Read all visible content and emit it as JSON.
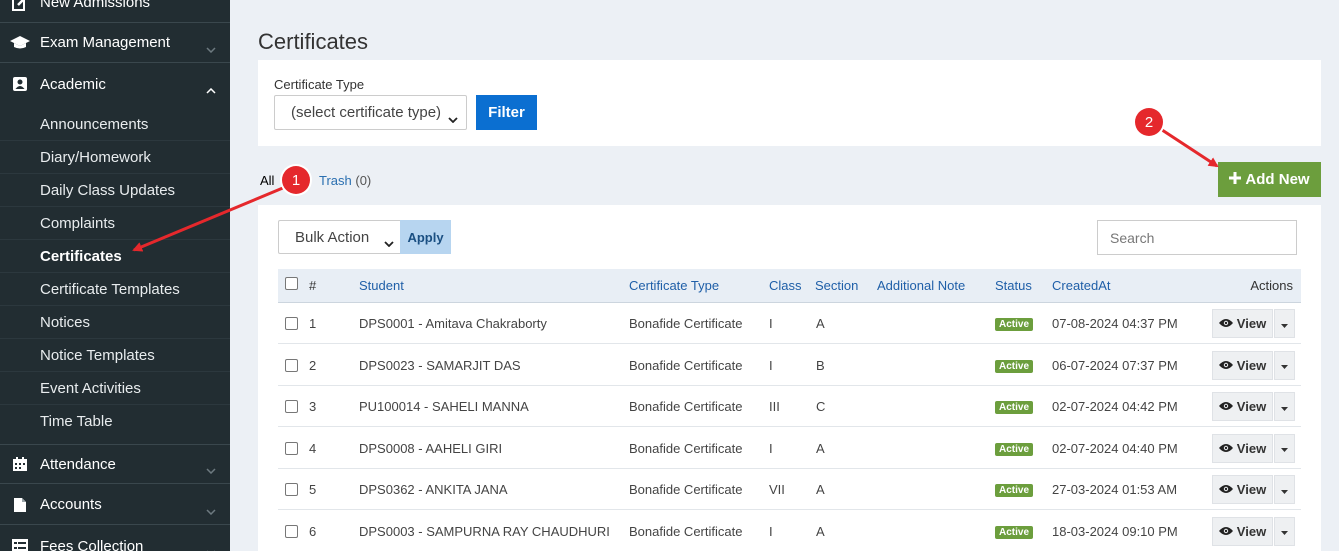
{
  "sidebar": {
    "top_items": [
      {
        "label": "New Admissions",
        "icon": "edit-icon"
      },
      {
        "label": "Exam Management",
        "icon": "graduation-cap-icon"
      },
      {
        "label": "Academic",
        "icon": "id-card-icon"
      }
    ],
    "sub_items": [
      "Announcements",
      "Diary/Homework",
      "Daily Class Updates",
      "Complaints",
      "Certificates",
      "Certificate Templates",
      "Notices",
      "Notice Templates",
      "Event Activities",
      "Time Table"
    ],
    "bottom_items": [
      {
        "label": "Attendance",
        "icon": "calendar-icon"
      },
      {
        "label": "Accounts",
        "icon": "file-icon"
      },
      {
        "label": "Fees Collection",
        "icon": "list-icon"
      }
    ]
  },
  "page": {
    "title": "Certificates"
  },
  "filter": {
    "label": "Certificate Type",
    "select_value": "(select certificate type)",
    "button": "Filter"
  },
  "tabs": {
    "all": "All",
    "trash": "Trash",
    "trash_count": "(0)"
  },
  "add_new": "Add New",
  "toolbar": {
    "bulk_action": "Bulk Action",
    "apply": "Apply",
    "search_placeholder": "Search"
  },
  "table": {
    "headers": {
      "num": "#",
      "student": "Student",
      "type": "Certificate Type",
      "class": "Class",
      "section": "Section",
      "note": "Additional Note",
      "status": "Status",
      "created": "CreatedAt",
      "actions": "Actions"
    },
    "rows": [
      {
        "num": "1",
        "student": "DPS0001 - Amitava Chakraborty",
        "type": "Bonafide Certificate",
        "class": "I",
        "section": "A",
        "status": "Active",
        "created": "07-08-2024 04:37 PM"
      },
      {
        "num": "2",
        "student": "DPS0023 - SAMARJIT DAS",
        "type": "Bonafide Certificate",
        "class": "I",
        "section": "B",
        "status": "Active",
        "created": "06-07-2024 07:37 PM"
      },
      {
        "num": "3",
        "student": "PU100014 - SAHELI MANNA",
        "type": "Bonafide Certificate",
        "class": "III",
        "section": "C",
        "status": "Active",
        "created": "02-07-2024 04:42 PM"
      },
      {
        "num": "4",
        "student": "DPS0008 - AAHELI GIRI",
        "type": "Bonafide Certificate",
        "class": "I",
        "section": "A",
        "status": "Active",
        "created": "02-07-2024 04:40 PM"
      },
      {
        "num": "5",
        "student": "DPS0362 - ANKITA JANA",
        "type": "Bonafide Certificate",
        "class": "VII",
        "section": "A",
        "status": "Active",
        "created": "27-03-2024 01:53 AM"
      },
      {
        "num": "6",
        "student": "DPS0003 - SAMPURNA RAY CHAUDHURI",
        "type": "Bonafide Certificate",
        "class": "I",
        "section": "A",
        "status": "Active",
        "created": "18-03-2024 09:10 PM"
      }
    ],
    "view_label": "View"
  },
  "annotations": {
    "callout_1": "1",
    "callout_2": "2"
  },
  "colors": {
    "sidebar": "#222d32",
    "primary": "#0b6fd1",
    "success": "#6c9e3d",
    "callout": "#e5282c"
  }
}
